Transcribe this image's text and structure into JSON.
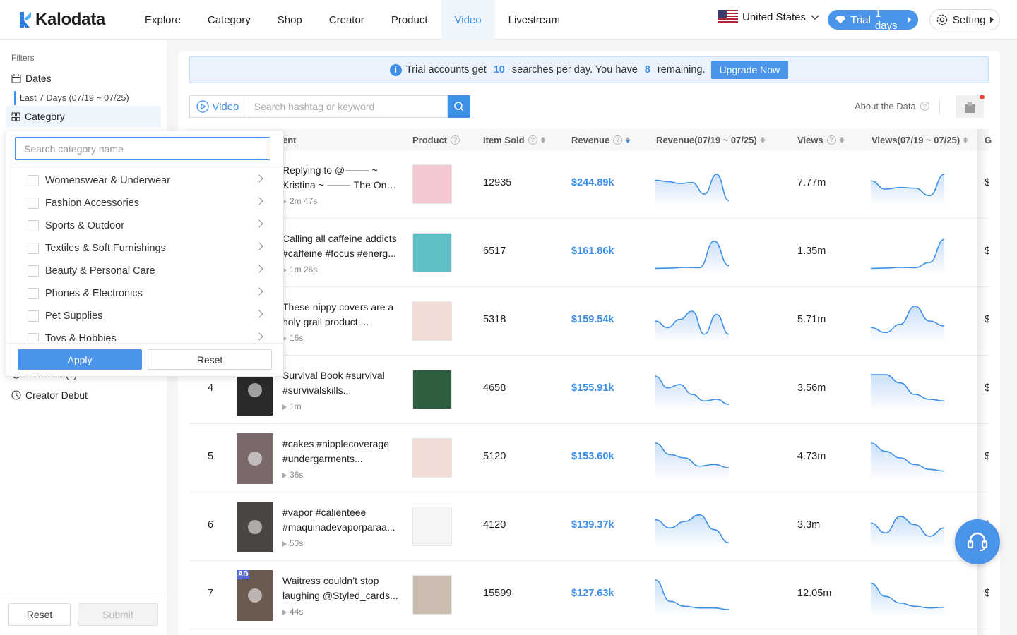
{
  "app": {
    "logo": "Kalodata"
  },
  "nav": {
    "items": [
      {
        "label": "Explore"
      },
      {
        "label": "Category"
      },
      {
        "label": "Shop"
      },
      {
        "label": "Creator"
      },
      {
        "label": "Product"
      },
      {
        "label": "Video",
        "active": true
      },
      {
        "label": "Livestream"
      }
    ],
    "country": "United States",
    "trial_label": "Trial",
    "trial_days": "1 days",
    "setting": "Setting"
  },
  "sidebar": {
    "title": "Filters",
    "dates_label": "Dates",
    "dates_value": "Last 7 Days (07/19 ~ 07/25)",
    "category_label": "Category",
    "duration_label": "Duration (s)",
    "creator_debut_label": "Creator Debut",
    "reset": "Reset",
    "submit": "Submit"
  },
  "category_dropdown": {
    "placeholder": "Search category name",
    "items": [
      "Womenswear & Underwear",
      "Fashion Accessories",
      "Sports & Outdoor",
      "Textiles & Soft Furnishings",
      "Beauty & Personal Care",
      "Phones & Electronics",
      "Pet Supplies",
      "Toys & Hobbies"
    ],
    "apply": "Apply",
    "reset": "Reset"
  },
  "banner": {
    "text1": "Trial accounts get",
    "n1": "10",
    "text2": "searches per day. You have",
    "n2": "8",
    "text3": "remaining.",
    "button": "Upgrade Now"
  },
  "search": {
    "tab": "Video",
    "placeholder": "Search hashtag or keyword",
    "about": "About the Data"
  },
  "table": {
    "headers": {
      "content": "ent",
      "product": "Product",
      "item_sold": "Item Sold",
      "revenue": "Revenue",
      "revenue_range": "Revenue(07/19 ~ 07/25)",
      "views": "Views",
      "views_range": "Views(07/19 ~ 07/25)",
      "next": "G"
    },
    "rows": [
      {
        "rank": "",
        "desc": "Replying to @⸻ ~ Kristina ~ ⸻ The One Size Settin...",
        "duration": "2m 47s",
        "sold": "12935",
        "revenue": "$244.89k",
        "views": "7.77m",
        "g": "$",
        "rev_trend": [
          0.62,
          0.58,
          0.52,
          0.55,
          0.2,
          0.8,
          0.0
        ],
        "view_trend": [
          0.6,
          0.35,
          0.4,
          0.38,
          0.15,
          0.8
        ]
      },
      {
        "rank": "",
        "desc": "Calling all caffeine addicts #caffeine #focus #energ...",
        "duration": "1m 26s",
        "sold": "6517",
        "revenue": "$161.86k",
        "views": "1.35m",
        "g": "$",
        "rev_trend": [
          0.02,
          0.03,
          0.05,
          0.04,
          0.85,
          0.1
        ],
        "view_trend": [
          0.02,
          0.03,
          0.05,
          0.04,
          0.2,
          0.9
        ]
      },
      {
        "rank": "",
        "desc": "These nippy covers are a holy grail product....",
        "duration": "16s",
        "sold": "5318",
        "revenue": "$159.54k",
        "views": "5.71m",
        "g": "$",
        "rev_trend": [
          0.5,
          0.3,
          0.55,
          0.8,
          0.1,
          0.7,
          0.1
        ],
        "view_trend": [
          0.3,
          0.15,
          0.4,
          0.95,
          0.5,
          0.35
        ]
      },
      {
        "rank": "4",
        "desc": "Survival Book #survival #survivalskills...",
        "duration": "1m",
        "sold": "4658",
        "revenue": "$155.91k",
        "views": "3.56m",
        "g": "$",
        "rev_trend": [
          0.9,
          0.55,
          0.65,
          0.35,
          0.15,
          0.2,
          0.05
        ],
        "view_trend": [
          0.95,
          0.95,
          0.7,
          0.35,
          0.2,
          0.15
        ]
      },
      {
        "rank": "5",
        "desc": "#cakes #nipplecoverage #undergarments...",
        "duration": "36s",
        "sold": "5120",
        "revenue": "$153.60k",
        "views": "4.73m",
        "g": "$",
        "rev_trend": [
          0.95,
          0.6,
          0.5,
          0.25,
          0.3,
          0.2
        ],
        "view_trend": [
          0.95,
          0.7,
          0.5,
          0.3,
          0.15,
          0.1
        ]
      },
      {
        "rank": "6",
        "desc": "#vapor #calienteee #maquinadevaporparaa...",
        "duration": "53s",
        "sold": "4120",
        "revenue": "$139.37k",
        "views": "3.3m",
        "g": "$",
        "rev_trend": [
          0.7,
          0.45,
          0.65,
          0.85,
          0.4,
          0.0
        ],
        "view_trend": [
          0.6,
          0.3,
          0.8,
          0.55,
          0.2,
          0.45
        ]
      },
      {
        "rank": "7",
        "desc": "Waitress couldn’t stop laughing @Styled_cards...",
        "duration": "44s",
        "sold": "15599",
        "revenue": "$127.63k",
        "views": "12.05m",
        "g": "$",
        "rev_trend": [
          0.95,
          0.3,
          0.15,
          0.1,
          0.1,
          0.05
        ],
        "view_trend": [
          0.85,
          0.45,
          0.25,
          0.15,
          0.1,
          0.12
        ]
      }
    ]
  },
  "colors": {
    "accent": "#3e8fe8",
    "banner_bg": "#eaf3fd"
  }
}
